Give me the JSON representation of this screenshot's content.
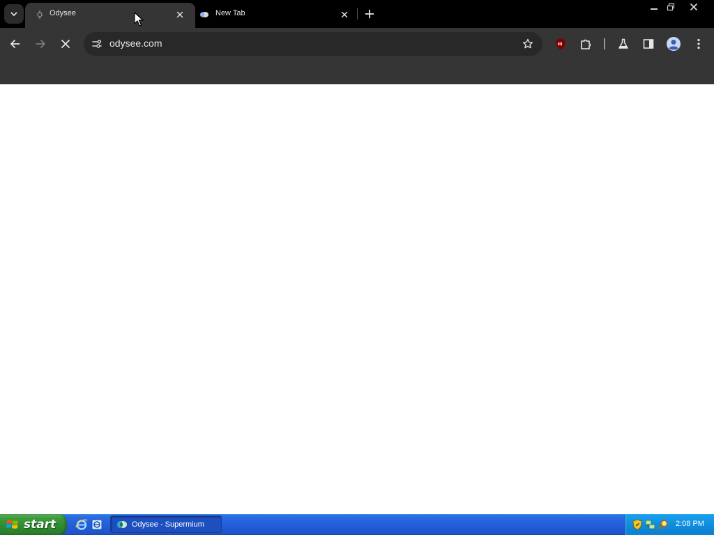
{
  "browser": {
    "tabs": [
      {
        "title": "Odysee",
        "active": true,
        "favicon": "odysee-favicon-icon"
      },
      {
        "title": "New Tab",
        "active": false,
        "favicon": "supermium-favicon-icon"
      }
    ],
    "address_bar": {
      "url": "odysee.com"
    },
    "toolbar_icons": [
      "back-icon",
      "forward-icon",
      "stop-loading-icon",
      "site-info-icon",
      "bookmark-star-icon",
      "ublock-icon",
      "extensions-icon",
      "labs-flask-icon",
      "side-panel-icon",
      "profile-icon",
      "menu-icon"
    ]
  },
  "taskbar": {
    "start_label": "start",
    "task_button_label": "Odysee - Supermium",
    "clock": "2:08 PM"
  },
  "colors": {
    "tab_strip": "#000000",
    "toolbar": "#353535",
    "omnibox": "#282828",
    "taskbar_blue": "#245edb",
    "start_green": "#2f8a2f",
    "tray_blue": "#0f8ee0"
  }
}
